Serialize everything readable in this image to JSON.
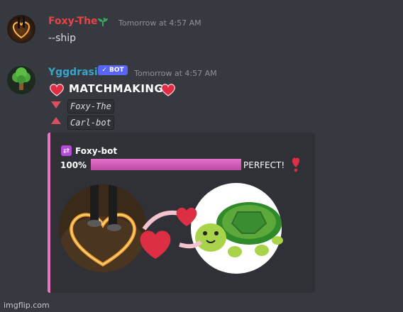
{
  "messages": [
    {
      "username": "Foxy-The",
      "username_color": "#ed4245",
      "timestamp": "Tomorrow at 4:57 AM",
      "text": "--ship",
      "avatar_icon": "fire-heart-avatar",
      "badge_icon": "seedling-icon"
    },
    {
      "username": "Yggdrasil",
      "username_color": "#3ba3c7",
      "bot_badge": "✓ BOT",
      "timestamp": "Tomorrow at 4:57 AM",
      "avatar_icon": "tree-avatar",
      "heading": "MATCHMAKING",
      "heading_icon": "heart-icon",
      "lines": [
        {
          "icon": "triangle-down-icon",
          "name": "Foxy-The"
        },
        {
          "icon": "triangle-up-icon",
          "name": "Carl-bot"
        }
      ],
      "embed": {
        "accent": "#ea75c0",
        "author_icon": "shuffle-icon",
        "author": "Foxy-bot",
        "percent_label": "100%",
        "progress": 1.0,
        "result": "PERFECT!",
        "result_icon": "exclamation-heart-icon",
        "image_icons": [
          "fire-heart-photo",
          "hearts-icon",
          "turtle-icon"
        ]
      }
    }
  ],
  "watermark": "imgflip.com",
  "colors": {
    "background": "#36393f",
    "embed_bg": "#2f3136",
    "heart": "#dd2e44",
    "bot_badge": "#5865f2"
  }
}
